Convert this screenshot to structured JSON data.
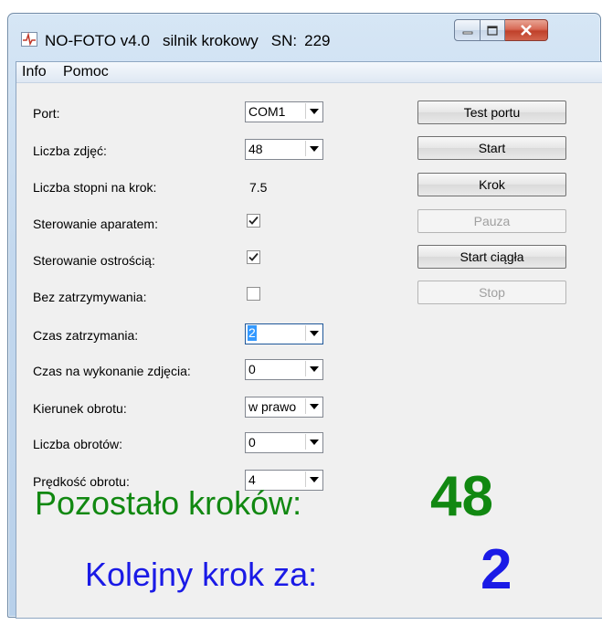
{
  "window": {
    "app_name": "NO-FOTO v4.0",
    "subtitle": "silnik krokowy",
    "sn_label": "SN:",
    "sn_value": "229"
  },
  "menu": [
    "Info",
    "Pomoc"
  ],
  "fields": {
    "port": {
      "label": "Port:",
      "value": "COM1"
    },
    "photo_count": {
      "label": "Liczba zdjęć:",
      "value": "48"
    },
    "degrees_per_step": {
      "label": "Liczba stopni na krok:",
      "value": "7.5"
    },
    "camera_control": {
      "label": "Sterowanie aparatem:",
      "checked": true
    },
    "focus_control": {
      "label": "Sterowanie ostrością:",
      "checked": true
    },
    "no_stop": {
      "label": "Bez zatrzymywania:",
      "checked": false
    },
    "stop_time": {
      "label": "Czas zatrzymania:",
      "value": "2"
    },
    "photo_time": {
      "label": "Czas na wykonanie zdjęcia:",
      "value": "0"
    },
    "direction": {
      "label": "Kierunek obrotu:",
      "value": "w prawo"
    },
    "rotations": {
      "label": "Liczba obrotów:",
      "value": "0"
    },
    "speed": {
      "label": "Prędkość obrotu:",
      "value": "4"
    }
  },
  "buttons": {
    "test_port": "Test portu",
    "start": "Start",
    "step": "Krok",
    "pause": "Pauza",
    "start_continuous": "Start ciągła",
    "stop": "Stop"
  },
  "status": {
    "remaining_label": "Pozostało kroków:",
    "remaining_value": "48",
    "next_label": "Kolejny krok za:",
    "next_value": "2"
  },
  "colors": {
    "remaining": "#118811",
    "next": "#1a1ae6",
    "selection": "#3399ff"
  },
  "icons": [
    "app-icon",
    "minimize-icon",
    "maximize-icon",
    "close-icon",
    "checkmark-icon",
    "dropdown-arrow-icon"
  ]
}
